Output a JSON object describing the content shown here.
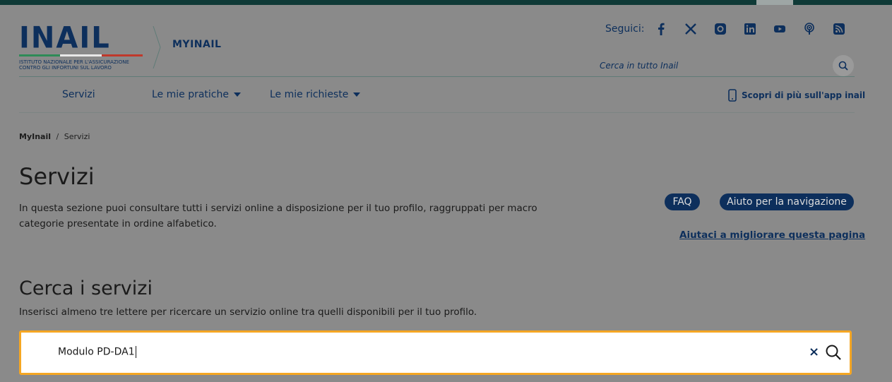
{
  "brand": {
    "wordmark": "INAIL",
    "subtitle": "ISTITUTO NAZIONALE PER L'ASSICURAZIONE\nCONTRO GLI INFORTUNI SUL LAVORO",
    "section": "MYINAIL",
    "colors": {
      "primary": "#0d2f5c",
      "green": "#2e8b57",
      "red": "#c0392b",
      "accent_focus": "#f5a623"
    }
  },
  "social": {
    "label": "Seguici:",
    "icons": [
      "facebook-icon",
      "x-icon",
      "instagram-icon",
      "linkedin-icon",
      "youtube-icon",
      "podcast-icon",
      "rss-icon"
    ]
  },
  "site_search": {
    "placeholder": "Cerca in tutto Inail"
  },
  "nav": {
    "items": [
      {
        "label": "Servizi"
      },
      {
        "label": "Le mie pratiche"
      },
      {
        "label": "Le mie richieste"
      }
    ],
    "app_link": "Scopri di più sull'app inail"
  },
  "breadcrumb": {
    "root": "MyInail",
    "sep": "/",
    "current": "Servizi"
  },
  "page": {
    "title": "Servizi",
    "intro": "In questa sezione puoi consultare tutti i servizi online a disposizione per il tuo profilo, raggruppati per macro categorie presentate in ordine alfabetico.",
    "faq": "FAQ",
    "help": "Aiuto per la navigazione",
    "improve": "Aiutaci a migliorare questa pagina"
  },
  "service_search": {
    "title": "Cerca i servizi",
    "hint": "Inserisci almeno tre lettere per ricercare un servizio online tra quelli disponibili per il tuo profilo.",
    "value": "Modulo PD-DA1",
    "clear_symbol": "×"
  }
}
